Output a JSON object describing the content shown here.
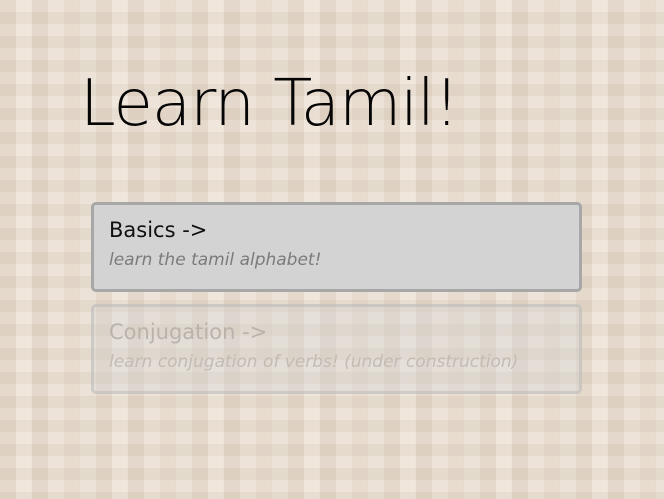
{
  "page": {
    "title": "Learn Tamil!"
  },
  "menu": {
    "items": [
      {
        "title": "Basics ->",
        "description": "learn the tamil alphabet!",
        "state": "active"
      },
      {
        "title": "Conjugation ->",
        "description": "learn conjugation of verbs! (under construction)",
        "state": "disabled"
      }
    ]
  }
}
